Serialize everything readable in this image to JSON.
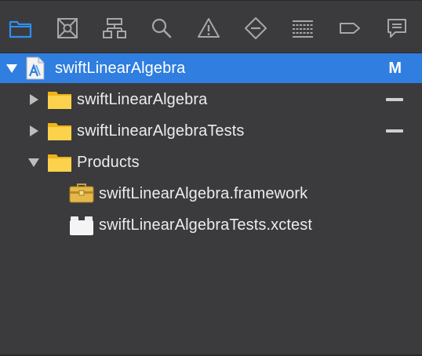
{
  "toolbar": {
    "buttons": [
      {
        "icon": "folder-icon",
        "name": "project-navigator-tab",
        "active": true
      },
      {
        "icon": "source-control-icon",
        "name": "source-control-navigator-tab"
      },
      {
        "icon": "symbol-hierarchy-icon",
        "name": "symbol-navigator-tab"
      },
      {
        "icon": "magnifier-icon",
        "name": "find-navigator-tab"
      },
      {
        "icon": "warning-triangle-icon",
        "name": "issue-navigator-tab"
      },
      {
        "icon": "test-diamond-icon",
        "name": "test-navigator-tab"
      },
      {
        "icon": "debug-lines-icon",
        "name": "debug-navigator-tab"
      },
      {
        "icon": "breakpoint-tag-icon",
        "name": "breakpoint-navigator-tab"
      },
      {
        "icon": "report-bubble-icon",
        "name": "report-navigator-tab"
      }
    ],
    "active_color": "#2f8ef4",
    "icon_color": "#a7a7a7"
  },
  "tree": {
    "selection_color": "#2f7ee0",
    "rows": [
      {
        "label": "swiftLinearAlgebra",
        "icon": "xcode-project-icon",
        "disclosure": "expanded",
        "status": "M",
        "selected": true
      },
      {
        "label": "swiftLinearAlgebra",
        "icon": "folder-icon",
        "disclosure": "collapsed",
        "status": "dash"
      },
      {
        "label": "swiftLinearAlgebraTests",
        "icon": "folder-icon",
        "disclosure": "collapsed",
        "status": "dash"
      },
      {
        "label": "Products",
        "icon": "folder-icon",
        "disclosure": "expanded",
        "status": ""
      },
      {
        "label": "swiftLinearAlgebra.framework",
        "icon": "framework-toolbox-icon",
        "disclosure": "",
        "status": ""
      },
      {
        "label": "swiftLinearAlgebraTests.xctest",
        "icon": "xctest-bundle-icon",
        "disclosure": "",
        "status": ""
      }
    ]
  }
}
